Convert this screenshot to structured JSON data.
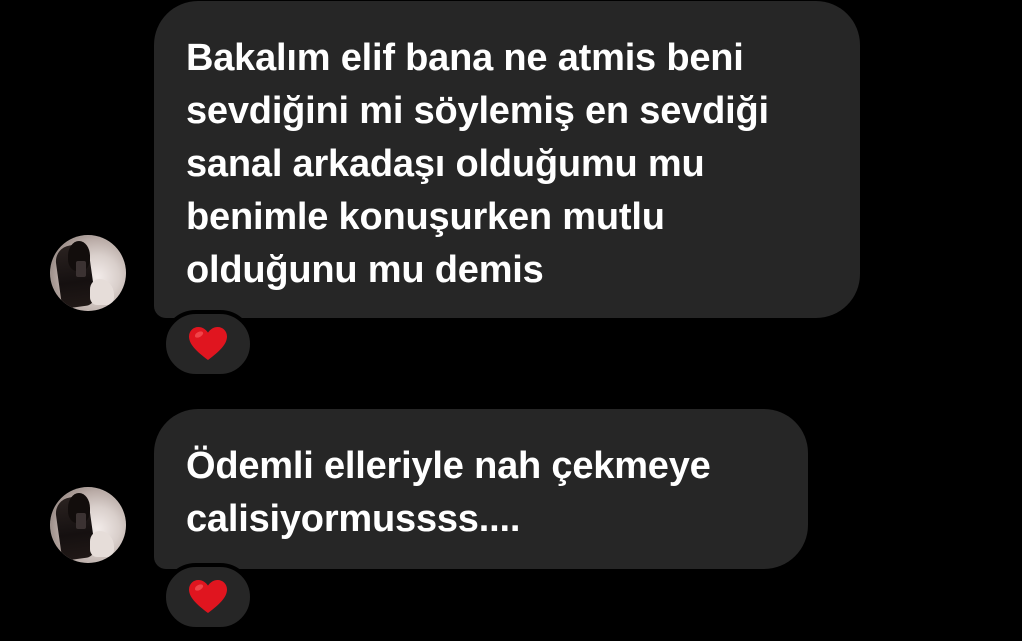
{
  "messages": [
    {
      "text": "Bakalım elif bana ne atmis beni\nsevdiğini mi söylemiş en sevdiği\nsanal arkadaşı olduğumu mu\nbenimle konuşurken mutlu\nolduğunu mu demis",
      "reaction": "heart-icon"
    },
    {
      "text": "Ödemli elleriyle nah çekmeye\ncalisiyormussss....",
      "reaction": "heart-icon"
    }
  ],
  "colors": {
    "background": "#000000",
    "bubble": "#262626",
    "text": "#ffffff",
    "heart": "#e0151f"
  }
}
